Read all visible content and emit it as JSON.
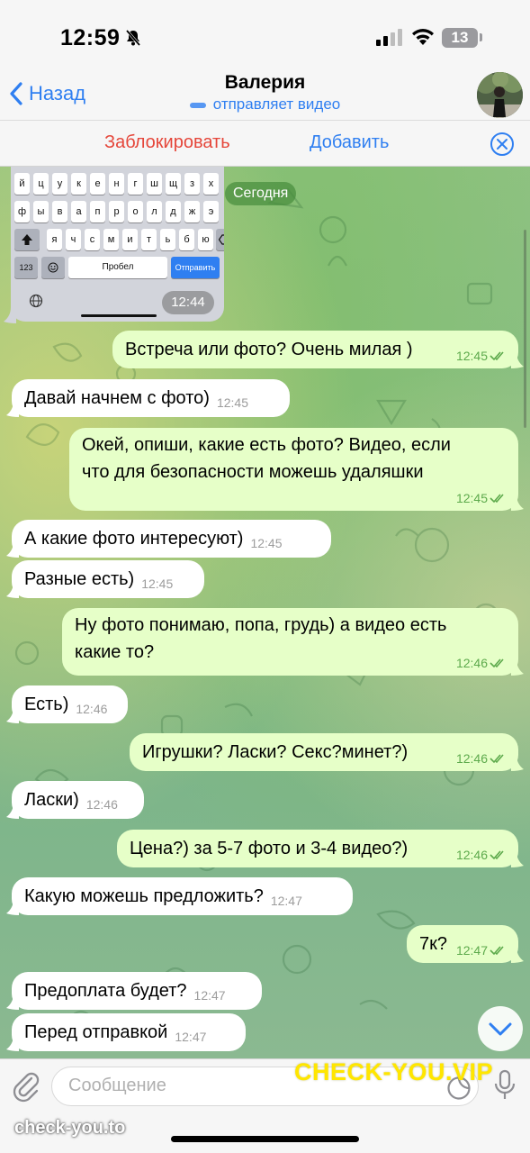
{
  "status": {
    "time": "12:59",
    "battery": "13"
  },
  "header": {
    "back_label": "Назад",
    "contact_name": "Валерия",
    "contact_status": "отправляет видео"
  },
  "actions": {
    "block_label": "Заблокировать",
    "add_label": "Добавить"
  },
  "chat": {
    "date_label": "Сегодня",
    "keyboard_shot": {
      "rows": [
        [
          "й",
          "ц",
          "у",
          "к",
          "е",
          "н",
          "г",
          "ш",
          "щ",
          "з",
          "х"
        ],
        [
          "ф",
          "ы",
          "в",
          "а",
          "п",
          "р",
          "о",
          "л",
          "д",
          "ж",
          "э"
        ],
        [
          "я",
          "ч",
          "с",
          "м",
          "и",
          "т",
          "ь",
          "б",
          "ю"
        ]
      ],
      "numbers_key": "123",
      "space_key": "Пробел",
      "send_key": "Отправить",
      "time": "12:44"
    },
    "messages": [
      {
        "dir": "out",
        "text": "Встреча или фото? Очень милая )",
        "time": "12:45"
      },
      {
        "dir": "in",
        "text": "Давай начнем с фото)",
        "time": "12:45"
      },
      {
        "dir": "out",
        "text": "Окей, опиши, какие есть фото? Видео, если что для безопасности можешь удаляшки",
        "time": "12:45"
      },
      {
        "dir": "in",
        "text": "А какие фото интересуют)",
        "time": "12:45"
      },
      {
        "dir": "in",
        "text": "Разные есть)",
        "time": "12:45"
      },
      {
        "dir": "out",
        "text": "Ну фото понимаю, попа, грудь) а видео есть какие то?",
        "time": "12:46"
      },
      {
        "dir": "in",
        "text": "Есть)",
        "time": "12:46"
      },
      {
        "dir": "out",
        "text": "Игрушки? Ласки? Секс?минет?)",
        "time": "12:46"
      },
      {
        "dir": "in",
        "text": "Ласки)",
        "time": "12:46"
      },
      {
        "dir": "out",
        "text": "Цена?) за 5-7 фото и 3-4 видео?)",
        "time": "12:46"
      },
      {
        "dir": "in",
        "text": "Какую можешь предложить?",
        "time": "12:47"
      },
      {
        "dir": "out",
        "text": "7к?",
        "time": "12:47"
      },
      {
        "dir": "in",
        "text": "Предоплата будет?",
        "time": "12:47"
      },
      {
        "dir": "in",
        "text": "Перед отправкой",
        "time": "12:47"
      }
    ]
  },
  "composer": {
    "placeholder": "Сообщение"
  },
  "watermarks": {
    "big": "CHECK-YOU.VIP",
    "small": "check-you.to"
  },
  "colors": {
    "accent": "#2f7ff1",
    "danger": "#e5463a",
    "outgoing_bubble": "#e6ffc8",
    "read_check": "#5daa4c"
  }
}
